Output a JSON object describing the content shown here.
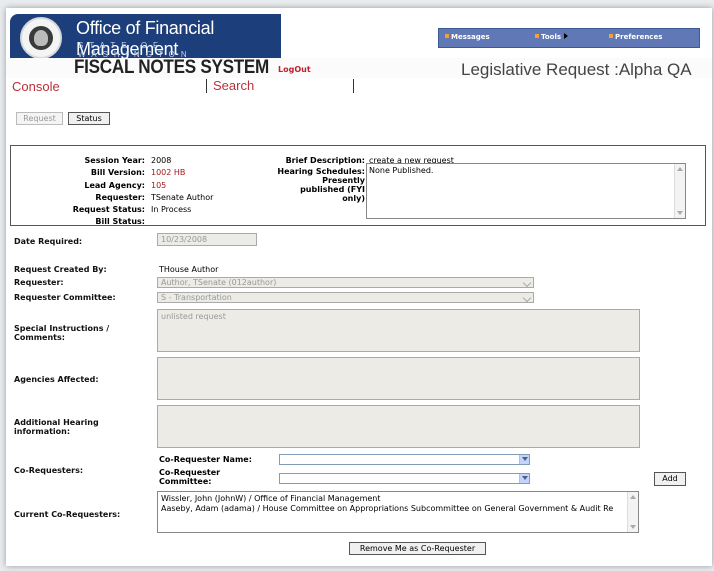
{
  "header": {
    "org_title": "Office of Financial Management",
    "org_subtitle": "STATE OF WASHINGTON",
    "system_title": "FISCAL NOTES SYSTEM",
    "logout_label": "LogOut",
    "page_title": "Legislative Request :Alpha QA",
    "nav": [
      {
        "label": "Messages"
      },
      {
        "label": "Tools"
      },
      {
        "label": "Preferences"
      }
    ]
  },
  "menu": {
    "console_label": "Console",
    "search_label": "Search"
  },
  "tabs": {
    "request_label": "Request",
    "status_label": "Status"
  },
  "summary": {
    "session_year_label": "Session Year:",
    "session_year": "2008",
    "bill_version_label": "Bill Version:",
    "bill_version": "1002 HB",
    "lead_agency_label": "Lead Agency:",
    "lead_agency": "105",
    "requester_label": "Requester:",
    "requester": "TSenate Author",
    "request_status_label": "Request Status:",
    "request_status": "In Process",
    "bill_status_label": "Bill Status:",
    "bill_status": "",
    "brief_description_label": "Brief Description:",
    "brief_description": "create a new request",
    "hearing_label_1": "Hearing Schedules:",
    "hearing_label_2": "Presently",
    "hearing_label_3": "published (FYI",
    "hearing_label_4": "only)",
    "hearing_value": "None Published."
  },
  "form": {
    "date_required_label": "Date Required:",
    "date_required": "10/23/2008",
    "created_by_label": "Request Created By:",
    "created_by": "THouse Author",
    "requester_label": "Requester:",
    "requester_value": "Author, TSenate (012author)",
    "requester_committee_label": "Requester Committee:",
    "requester_committee_value": "S - Transportation",
    "special_instructions_label_1": "Special Instructions /",
    "special_instructions_label_2": "Comments:",
    "special_instructions_value": "unlisted request",
    "agencies_affected_label": "Agencies Affected:",
    "additional_hearing_label_1": "Additional Hearing",
    "additional_hearing_label_2": "information:",
    "co_requesters_label": "Co-Requesters:",
    "co_requester_name_label": "Co-Requester Name:",
    "co_requester_committee_label_1": "Co-Requester",
    "co_requester_committee_label_2": "Committee:",
    "add_label": "Add",
    "current_co_requesters_label": "Current Co-Requesters:",
    "current_co_requesters": [
      "Wissler, John (JohnW) / Office of Financial Management",
      "Aaseby, Adam (adama) / House Committee on Appropriations Subcommittee on General Government & Audit Re"
    ],
    "remove_label": "Remove Me as Co-Requester"
  },
  "colors": {
    "brand_blue": "#1c3f7c",
    "nav_blue": "#6078b5",
    "accent_red": "#b8323a"
  }
}
